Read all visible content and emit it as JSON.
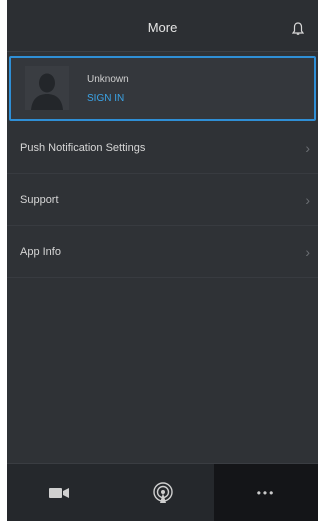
{
  "header": {
    "title": "More",
    "bell_icon": "bell-icon"
  },
  "account": {
    "name": "Unknown",
    "action": "SIGN IN",
    "avatar_icon": "person-silhouette-icon",
    "highlight_color": "#2f8fd6"
  },
  "menu": [
    {
      "label": "Push Notification Settings",
      "icon": "chevron-right-icon"
    },
    {
      "label": "Support",
      "icon": "chevron-right-icon"
    },
    {
      "label": "App Info",
      "icon": "chevron-right-icon"
    }
  ],
  "tabs": [
    {
      "icon": "video-camera-icon",
      "active": false
    },
    {
      "icon": "broadcast-tower-icon",
      "active": false
    },
    {
      "icon": "more-dots-icon",
      "label": "•••",
      "active": true
    }
  ],
  "colors": {
    "background": "#2f3236",
    "accent": "#3ba3e6",
    "tabbar": "#25282c"
  }
}
